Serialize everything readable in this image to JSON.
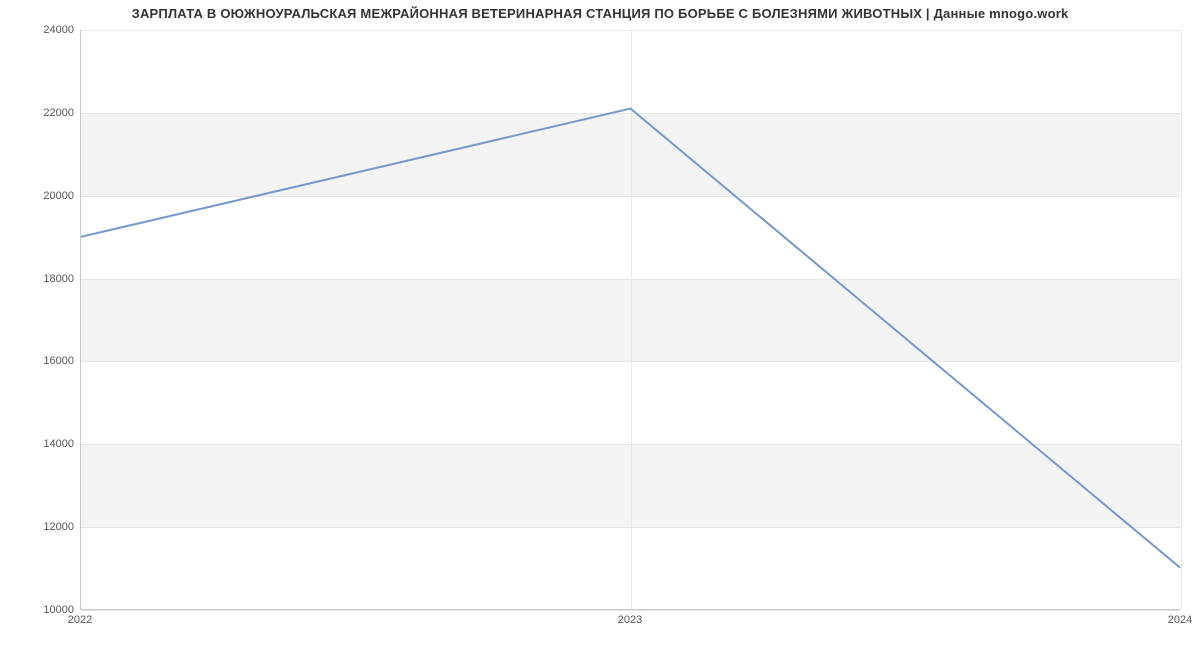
{
  "chart_data": {
    "type": "line",
    "title": "ЗАРПЛАТА В ОЮЖНОУРАЛЬСКАЯ МЕЖРАЙОННАЯ ВЕТЕРИНАРНАЯ СТАНЦИЯ ПО БОРЬБЕ С БОЛЕЗНЯМИ ЖИВОТНЫХ | Данные mnogo.work",
    "xlabel": "",
    "ylabel": "",
    "x": [
      "2022",
      "2023",
      "2024"
    ],
    "values": [
      19000,
      22100,
      11000
    ],
    "x_ticks": [
      "2022",
      "2023",
      "2024"
    ],
    "y_ticks": [
      10000,
      12000,
      14000,
      16000,
      18000,
      20000,
      22000,
      24000
    ],
    "ylim": [
      10000,
      24000
    ],
    "line_color": "#7698c9",
    "bands": true
  }
}
